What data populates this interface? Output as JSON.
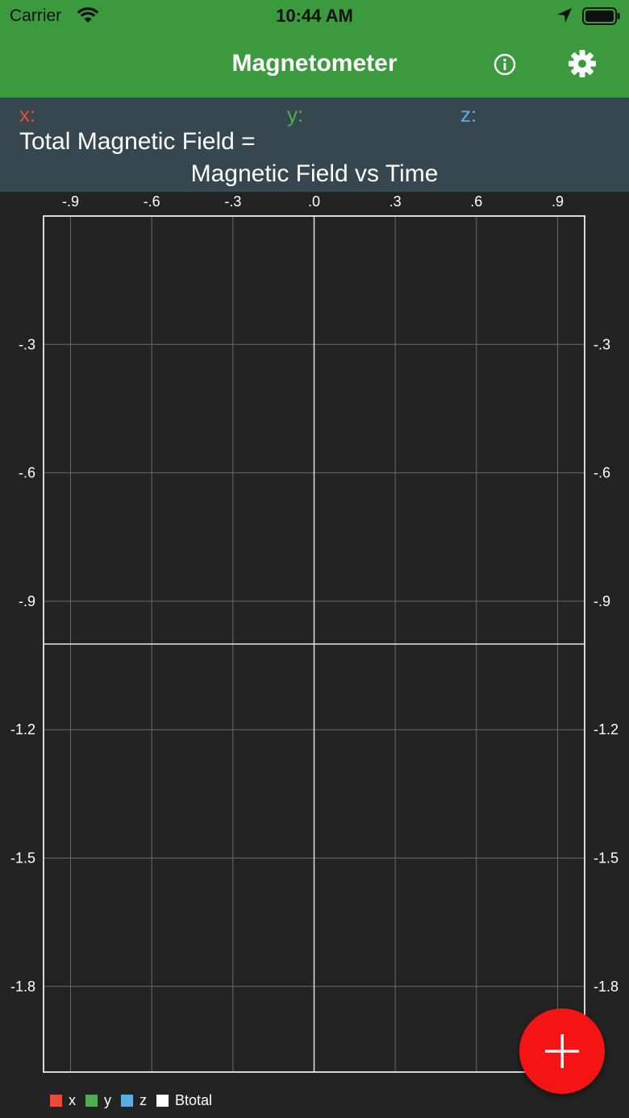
{
  "status_bar": {
    "carrier": "Carrier",
    "time": "10:44 AM"
  },
  "nav": {
    "title": "Magnetometer"
  },
  "readout": {
    "x_label": "x:",
    "y_label": "y:",
    "z_label": "z:",
    "total_label": "Total Magnetic Field ="
  },
  "chart_data": {
    "type": "line",
    "title": "Magnetic Field vs Time",
    "x_ticks": [
      -0.9,
      -0.6,
      -0.3,
      0.0,
      0.3,
      0.6,
      0.9
    ],
    "x_tick_labels": [
      "-.9",
      "-.6",
      "-.3",
      ".0",
      ".3",
      ".6",
      ".9"
    ],
    "y_ticks": [
      -0.3,
      -0.6,
      -0.9,
      -1.2,
      -1.5,
      -1.8
    ],
    "y_tick_labels": [
      "-.3",
      "-.6",
      "-.9",
      "-1.2",
      "-1.5",
      "-1.8"
    ],
    "xlim": [
      -1.0,
      1.0
    ],
    "ylim": [
      -2.0,
      0.0
    ],
    "baseline_y": -1.0,
    "grid": true,
    "legend_position": "bottom-left",
    "series": [
      {
        "name": "x",
        "color": "#e74c3c",
        "values": []
      },
      {
        "name": "y",
        "color": "#4caf50",
        "values": []
      },
      {
        "name": "z",
        "color": "#5dade2",
        "values": []
      },
      {
        "name": "Btotal",
        "color": "#ffffff",
        "values": []
      }
    ]
  },
  "colors": {
    "green": "#3b9a3e",
    "panel": "#37474f",
    "background": "#232323",
    "fab": "#f51414"
  },
  "icons": {
    "info": "info-icon",
    "settings": "gear-icon",
    "add": "plus-icon"
  }
}
